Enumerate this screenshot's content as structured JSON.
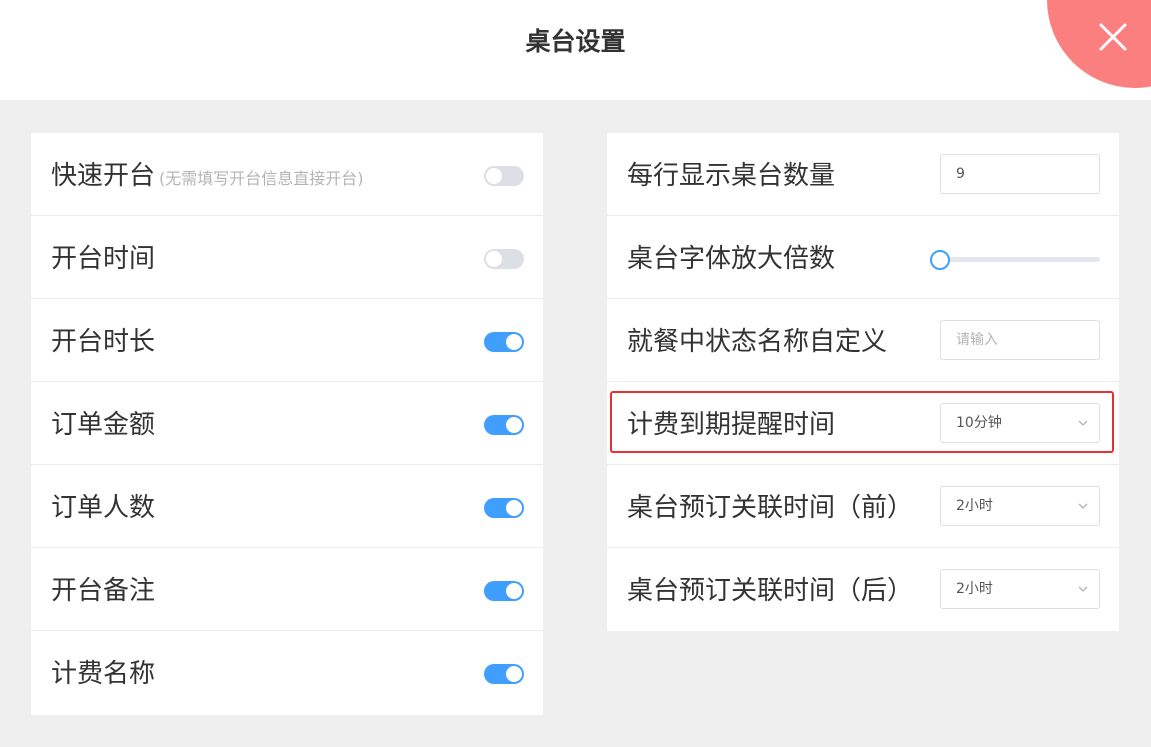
{
  "header": {
    "title": "桌台设置",
    "close_icon": "close-icon"
  },
  "left_panel": {
    "rows": [
      {
        "label": "快速开台",
        "hint": "(无需填写开台信息直接开台)",
        "enabled": false
      },
      {
        "label": "开台时间",
        "enabled": false
      },
      {
        "label": "开台时长",
        "enabled": true
      },
      {
        "label": "订单金额",
        "enabled": true
      },
      {
        "label": "订单人数",
        "enabled": true
      },
      {
        "label": "开台备注",
        "enabled": true
      },
      {
        "label": "计费名称",
        "enabled": true
      }
    ]
  },
  "right_panel": {
    "rows_per_line": {
      "label": "每行显示桌台数量",
      "value": "9"
    },
    "font_scale": {
      "label": "桌台字体放大倍数",
      "level": 0
    },
    "dining_status_name": {
      "label": "就餐中状态名称自定义",
      "placeholder": "请输入"
    },
    "billing_reminder": {
      "label": "计费到期提醒时间",
      "selected": "10分钟"
    },
    "reservation_before": {
      "label": "桌台预订关联时间（前）",
      "selected": "2小时"
    },
    "reservation_after": {
      "label": "桌台预订关联时间（后）",
      "selected": "2小时"
    }
  },
  "colors": {
    "accent": "#409eff",
    "close_bg": "#fc7f7f",
    "highlight": "#e8312e",
    "background": "#efefef"
  }
}
